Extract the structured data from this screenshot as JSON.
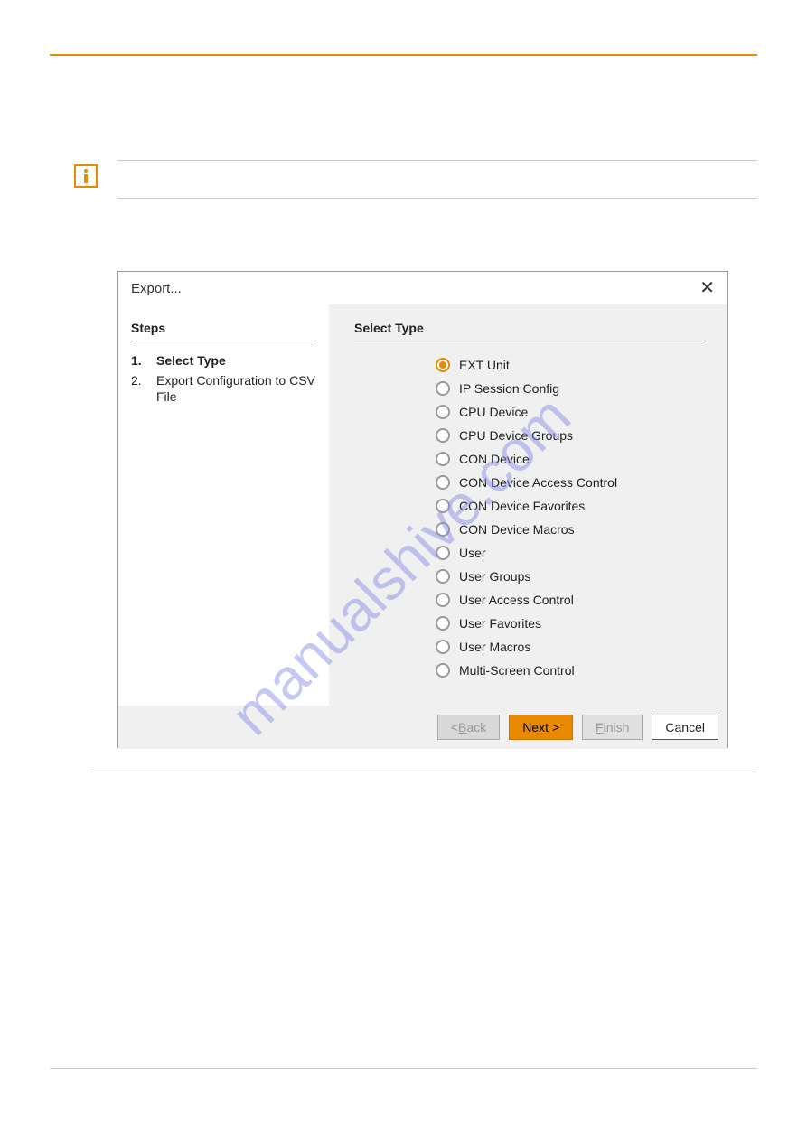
{
  "dialog": {
    "title": "Export...",
    "steps_header": "Steps",
    "steps": [
      {
        "num": "1.",
        "label": "Select Type",
        "bold": true
      },
      {
        "num": "2.",
        "label": "Export  Configuration to CSV File",
        "bold": false
      }
    ],
    "select_header": "Select Type",
    "radios": [
      {
        "label": "EXT Unit",
        "selected": true
      },
      {
        "label": "IP Session Config",
        "selected": false
      },
      {
        "label": "CPU Device",
        "selected": false
      },
      {
        "label": "CPU Device Groups",
        "selected": false
      },
      {
        "label": "CON Device",
        "selected": false
      },
      {
        "label": "CON Device Access Control",
        "selected": false
      },
      {
        "label": "CON Device Favorites",
        "selected": false
      },
      {
        "label": "CON Device Macros",
        "selected": false
      },
      {
        "label": "User",
        "selected": false
      },
      {
        "label": "User Groups",
        "selected": false
      },
      {
        "label": "User Access Control",
        "selected": false
      },
      {
        "label": "User Favorites",
        "selected": false
      },
      {
        "label": "User Macros",
        "selected": false
      },
      {
        "label": "Multi-Screen Control",
        "selected": false
      }
    ],
    "buttons": {
      "back_prefix": "< ",
      "back_u": "B",
      "back_rest": "ack",
      "next": "Next >",
      "finish_u": "F",
      "finish_rest": "inish",
      "cancel": "Cancel"
    }
  },
  "watermark": "manualshive.com"
}
